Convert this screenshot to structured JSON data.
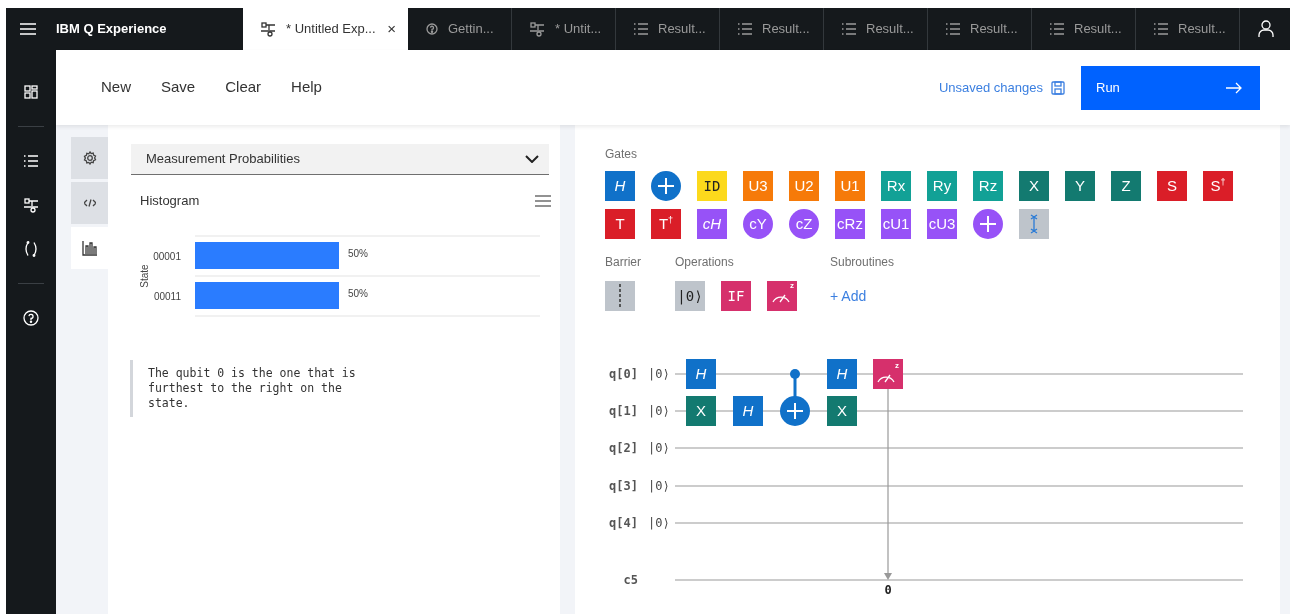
{
  "topbar": {
    "title": "IBM Q Experience",
    "tabs": [
      {
        "kind": "circuit",
        "label": "* Untitled Exp...",
        "selected": true,
        "close": "×"
      },
      {
        "kind": "help",
        "label": "Gettin...",
        "selected": false
      },
      {
        "kind": "circuit",
        "label": "* Untit...",
        "selected": false
      },
      {
        "kind": "list",
        "label": "Result...",
        "selected": false
      },
      {
        "kind": "list",
        "label": "Result...",
        "selected": false
      },
      {
        "kind": "list",
        "label": "Result...",
        "selected": false
      },
      {
        "kind": "list",
        "label": "Result...",
        "selected": false
      },
      {
        "kind": "list",
        "label": "Result...",
        "selected": false
      },
      {
        "kind": "list",
        "label": "Result...",
        "selected": false
      }
    ]
  },
  "sidebar": {
    "items": [
      {
        "kind": "dashboard"
      },
      {
        "kind": "divider"
      },
      {
        "kind": "list"
      },
      {
        "kind": "circuit"
      },
      {
        "kind": "bracket"
      },
      {
        "kind": "divider"
      },
      {
        "kind": "help"
      }
    ]
  },
  "toolbar": {
    "menu": [
      "New",
      "Save",
      "Clear",
      "Help"
    ],
    "status": "Unsaved changes",
    "run": "Run"
  },
  "left_panel": {
    "side_tabs": [
      {
        "kind": "settings",
        "selected": false
      },
      {
        "kind": "code",
        "selected": false
      },
      {
        "kind": "chart",
        "selected": true
      }
    ],
    "dropdown": {
      "label": "Measurement Probabilities"
    },
    "histogram": {
      "chart_data": {
        "type": "bar",
        "orientation": "horizontal",
        "title": "Histogram",
        "ylabel": "State",
        "categories": [
          "00001",
          "00011"
        ],
        "values": [
          50,
          50
        ],
        "value_labels": [
          "50%",
          "50%"
        ]
      }
    },
    "note": "The qubit 0 is the one that is furthest to the right on the state."
  },
  "right_panel": {
    "gates": {
      "label": "Gates",
      "items": [
        {
          "kind": "text",
          "label": "H",
          "italic": true,
          "color": "#1071c9"
        },
        {
          "kind": "plus",
          "color": "#1071c9"
        },
        {
          "kind": "mono",
          "label": "ID",
          "color": "#fcd91c"
        },
        {
          "kind": "text",
          "label": "U3",
          "color": "#f67a09"
        },
        {
          "kind": "text",
          "label": "U2",
          "color": "#f67a09"
        },
        {
          "kind": "text",
          "label": "U1",
          "color": "#f67a09"
        },
        {
          "kind": "text",
          "label": "Rx",
          "color": "#12a196"
        },
        {
          "kind": "text",
          "label": "Ry",
          "color": "#12a196"
        },
        {
          "kind": "text",
          "label": "Rz",
          "color": "#12a196"
        },
        {
          "kind": "text",
          "label": "X",
          "color": "#137a70"
        },
        {
          "kind": "text",
          "label": "Y",
          "color": "#137a70"
        },
        {
          "kind": "text",
          "label": "Z",
          "color": "#137a70"
        },
        {
          "kind": "text",
          "label": "S",
          "color": "#da1e28"
        },
        {
          "kind": "text",
          "label": "S$^{†}$",
          "color": "#da1e28"
        },
        {
          "kind": "text",
          "label": "T",
          "color": "#da1e28"
        },
        {
          "kind": "text",
          "label": "T$^{†}$",
          "color": "#da1e28"
        },
        {
          "kind": "text",
          "label": "cH",
          "italic": true,
          "color": "#9752f7"
        },
        {
          "kind": "disc",
          "label": "cY",
          "color": "#9752f7"
        },
        {
          "kind": "disc",
          "label": "cZ",
          "color": "#9752f7"
        },
        {
          "kind": "text",
          "label": "cRz",
          "color": "#9752f7"
        },
        {
          "kind": "text",
          "label": "cU1",
          "color": "#9752f7"
        },
        {
          "kind": "text",
          "label": "cU3",
          "color": "#9752f7"
        },
        {
          "kind": "plus",
          "color": "#9752f7"
        },
        {
          "kind": "swap",
          "color": "#bec4cb"
        }
      ]
    },
    "barrier": {
      "label": "Barrier",
      "items": [
        {
          "kind": "barrier",
          "color": "#bec4cb"
        }
      ]
    },
    "operations": {
      "label": "Operations",
      "items": [
        {
          "kind": "mono",
          "label": "|0⟩",
          "color": "#bec4cb"
        },
        {
          "kind": "mono",
          "label": "IF",
          "color": "#d6306c"
        },
        {
          "kind": "measure",
          "sup": "z",
          "color": "#d6306c"
        }
      ]
    },
    "subroutines": {
      "label": "Subroutines",
      "add": "+ Add"
    },
    "circuit": {
      "qubits": [
        {
          "label": "q[0]",
          "init": "|0⟩",
          "steps": [
            {
              "kind": "box",
              "label": "H",
              "italic": true,
              "color": "#1071c9"
            },
            {
              "kind": "gap"
            },
            {
              "kind": "control",
              "color": "#1071c9"
            },
            {
              "kind": "box",
              "label": "H",
              "italic": true,
              "color": "#1071c9"
            },
            {
              "kind": "measure",
              "sup": "z",
              "readout": "0",
              "color": "#d6306c"
            }
          ]
        },
        {
          "label": "q[1]",
          "init": "|0⟩",
          "steps": [
            {
              "kind": "box",
              "label": "X",
              "color": "#137a70"
            },
            {
              "kind": "box",
              "label": "H",
              "italic": true,
              "color": "#1071c9"
            },
            {
              "kind": "target",
              "color": "#1071c9"
            },
            {
              "kind": "box",
              "label": "X",
              "color": "#137a70"
            }
          ]
        },
        {
          "label": "q[2]",
          "init": "|0⟩"
        },
        {
          "label": "q[3]",
          "init": "|0⟩"
        },
        {
          "label": "q[4]",
          "init": "|0⟩"
        }
      ],
      "classical": {
        "label": "c5"
      }
    }
  }
}
